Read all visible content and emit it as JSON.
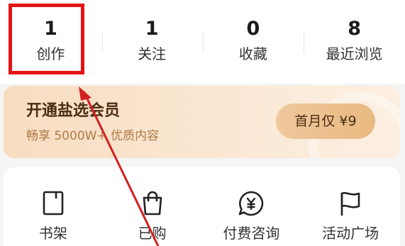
{
  "stats": [
    {
      "value": "1",
      "label": "创作"
    },
    {
      "value": "1",
      "label": "关注"
    },
    {
      "value": "0",
      "label": "收藏"
    },
    {
      "value": "8",
      "label": "最近浏览"
    }
  ],
  "vip": {
    "title": "开通盐选会员",
    "subtitle": "畅享 5000W+ 优质内容",
    "button_label": "首月仅 ¥9"
  },
  "shortcuts": [
    {
      "label": "书架",
      "icon": "bookshelf-icon"
    },
    {
      "label": "已购",
      "icon": "shopping-bag-icon"
    },
    {
      "label": "付费咨询",
      "icon": "paid-consult-icon"
    },
    {
      "label": "活动广场",
      "icon": "flag-icon"
    }
  ],
  "annotation": {
    "highlight_color": "#e41313",
    "arrow_color": "#d42020"
  },
  "colors": {
    "vip_bg": "#f7dcc0",
    "vip_button": "#efc89c",
    "vip_title": "#4a2c12",
    "vip_sub": "#b07a45"
  }
}
